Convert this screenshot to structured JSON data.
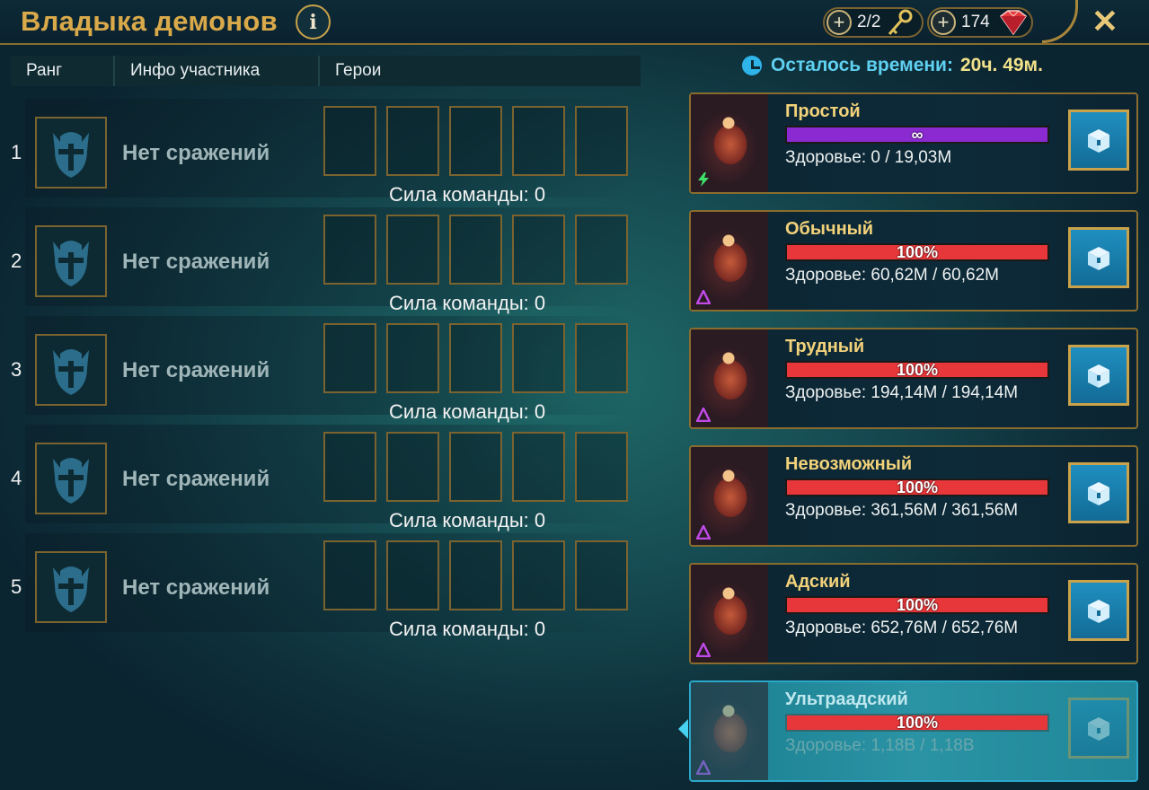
{
  "header": {
    "title": "Владыка демонов",
    "info_label": "i",
    "keys_value": "2/2",
    "gems_value": "174",
    "close_label": "✕"
  },
  "table": {
    "columns": [
      "Ранг",
      "Инфо участника",
      "Герои"
    ],
    "rows": [
      {
        "rank": "1",
        "info": "Нет сражений",
        "power": "Сила команды: 0"
      },
      {
        "rank": "2",
        "info": "Нет сражений",
        "power": "Сила команды: 0"
      },
      {
        "rank": "3",
        "info": "Нет сражений",
        "power": "Сила команды: 0"
      },
      {
        "rank": "4",
        "info": "Нет сражений",
        "power": "Сила команды: 0"
      },
      {
        "rank": "5",
        "info": "Нет сражений",
        "power": "Сила команды: 0"
      }
    ]
  },
  "timer": {
    "label": "Осталось времени:",
    "value": "20ч. 49м."
  },
  "difficulties": [
    {
      "name": "Простой",
      "bar_label": "∞",
      "health_fraction": 1.0,
      "bar_color": "#8a2ad0",
      "health": "Здоровье: 0 / 19,03M",
      "icon": "lightning-icon"
    },
    {
      "name": "Обычный",
      "bar_label": "100%",
      "health_fraction": 1.0,
      "bar_color": "#e8373a",
      "health": "Здоровье: 60,62M / 60,62M",
      "icon": "triangle-icon"
    },
    {
      "name": "Трудный",
      "bar_label": "100%",
      "health_fraction": 1.0,
      "bar_color": "#e8373a",
      "health": "Здоровье: 194,14M / 194,14M",
      "icon": "triangle-icon"
    },
    {
      "name": "Невозможный",
      "bar_label": "100%",
      "health_fraction": 1.0,
      "bar_color": "#e8373a",
      "health": "Здоровье: 361,56M / 361,56M",
      "icon": "triangle-icon"
    },
    {
      "name": "Адский",
      "bar_label": "100%",
      "health_fraction": 1.0,
      "bar_color": "#e8373a",
      "health": "Здоровье: 652,76M / 652,76M",
      "icon": "triangle-icon"
    },
    {
      "name": "Ультраадский",
      "bar_label": "100%",
      "health_fraction": 1.0,
      "bar_color": "#e8373a",
      "health": "Здоровье: 1,18B / 1,18B",
      "icon": "triangle-icon",
      "selected": true
    }
  ],
  "colors": {
    "gold_accent": "#d9a94a",
    "timer_label": "#5fd0f0",
    "timer_value": "#f2e28a",
    "health_bar": "#e8373a",
    "infinite_bar": "#8a2ad0",
    "selected_card": "#2a93a4"
  }
}
